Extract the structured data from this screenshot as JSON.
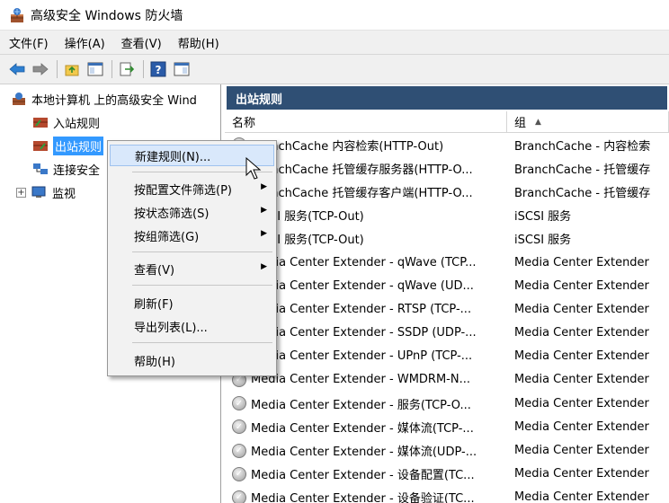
{
  "window": {
    "title": "高级安全 Windows 防火墙"
  },
  "menubar": [
    "文件(F)",
    "操作(A)",
    "查看(V)",
    "帮助(H)"
  ],
  "tree": {
    "root": "本地计算机 上的高级安全 Wind",
    "inbound": "入站规则",
    "outbound": "出站规则",
    "connection": "连接安全",
    "monitor": "监视"
  },
  "main": {
    "header": "出站规则",
    "columns": {
      "name": "名称",
      "group": "组"
    },
    "rows": [
      {
        "name": "BranchCache 内容检索(HTTP-Out)",
        "group": "BranchCache - 内容检索"
      },
      {
        "name": "BranchCache 托管缓存服务器(HTTP-O...",
        "group": "BranchCache - 托管缓存"
      },
      {
        "name": "BranchCache 托管缓存客户端(HTTP-O...",
        "group": "BranchCache - 托管缓存"
      },
      {
        "name": "iSCSI 服务(TCP-Out)",
        "group": "iSCSI 服务"
      },
      {
        "name": "iSCSI 服务(TCP-Out)",
        "group": "iSCSI 服务"
      },
      {
        "name": "Media Center Extender - qWave (TCP...",
        "group": "Media Center Extender"
      },
      {
        "name": "Media Center Extender - qWave (UD...",
        "group": "Media Center Extender"
      },
      {
        "name": "Media Center Extender - RTSP (TCP-...",
        "group": "Media Center Extender"
      },
      {
        "name": "Media Center Extender - SSDP (UDP-...",
        "group": "Media Center Extender"
      },
      {
        "name": "Media Center Extender - UPnP (TCP-...",
        "group": "Media Center Extender"
      },
      {
        "name": "Media Center Extender - WMDRM-N...",
        "group": "Media Center Extender"
      },
      {
        "name": "Media Center Extender - 服务(TCP-O...",
        "group": "Media Center Extender"
      },
      {
        "name": "Media Center Extender - 媒体流(TCP-...",
        "group": "Media Center Extender"
      },
      {
        "name": "Media Center Extender - 媒体流(UDP-...",
        "group": "Media Center Extender"
      },
      {
        "name": "Media Center Extender - 设备配置(TC...",
        "group": "Media Center Extender"
      },
      {
        "name": "Media Center Extender - 设备验证(TC...",
        "group": "Media Center Extender"
      }
    ]
  },
  "context_menu": {
    "new_rule": "新建规则(N)...",
    "filter_profile": "按配置文件筛选(P)",
    "filter_state": "按状态筛选(S)",
    "filter_group": "按组筛选(G)",
    "view": "查看(V)",
    "refresh": "刷新(F)",
    "export": "导出列表(L)...",
    "help": "帮助(H)"
  },
  "colors": {
    "header_bg": "#2f4f74",
    "selection": "#3399ff",
    "menu_highlight": "#d9e8fb"
  }
}
